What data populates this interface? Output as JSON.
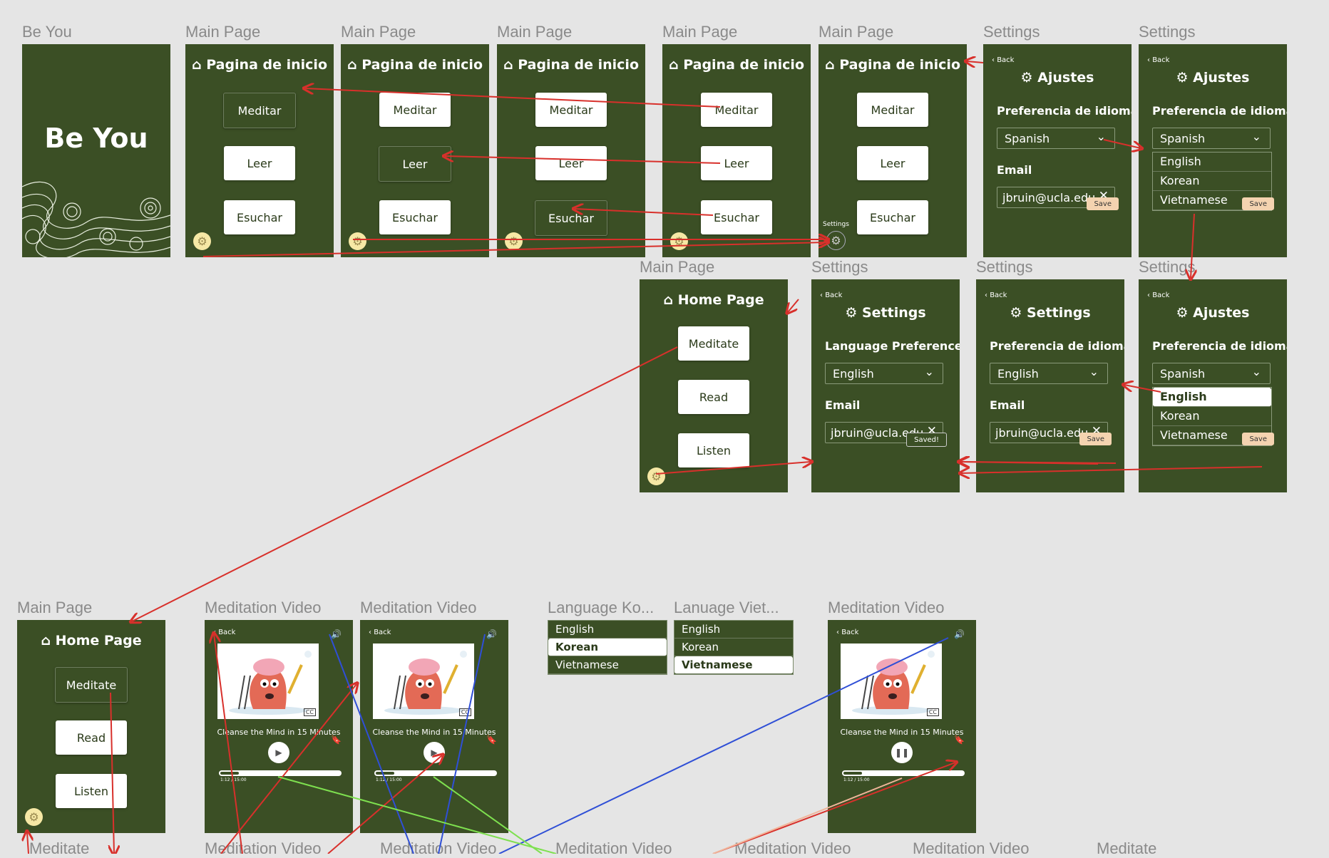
{
  "labels": {
    "be_you": "Be You",
    "main": "Main Page",
    "settings": "Settings",
    "video": "Meditation Video",
    "lang_ko": "Language Ko...",
    "lang_vi": "Lanuage Viet...",
    "meditate": "Meditate"
  },
  "splash": {
    "title": "Be You"
  },
  "main_es": {
    "title": "Pagina de inicio",
    "b1": "Meditar",
    "b2": "Leer",
    "b3": "Esuchar",
    "settings_tip": "Settings"
  },
  "main_en": {
    "title": "Home Page",
    "b1": "Meditate",
    "b2": "Read",
    "b3": "Listen"
  },
  "settings_es": {
    "back": "Back",
    "title": "Ajustes",
    "lang_label": "Preferencia de idioma",
    "lang_value": "Spanish",
    "email_label": "Email",
    "email_value": "jbruin@ucla.edu",
    "save": "Save",
    "options": [
      "English",
      "Korean",
      "Vietnamese"
    ]
  },
  "settings_en": {
    "back": "Back",
    "title": "Settings",
    "lang_label": "Language Preference",
    "lang_value": "English",
    "email_label": "Email",
    "email_value": "jbruin@ucla.edu",
    "saved": "Saved!"
  },
  "settings_mix": {
    "back": "Back",
    "title": "Settings",
    "lang_label": "Preferencia de idioma",
    "lang_value": "English",
    "email_label": "Email",
    "email_value": "jbruin@ucla.edu",
    "save": "Save"
  },
  "video": {
    "back": "Back",
    "caption": "Cleanse the Mind in 15 Minutes",
    "time": "1:12 / 15:00",
    "progress": 0.15
  },
  "lang_menu": {
    "options": [
      "English",
      "Korean",
      "Vietnamese"
    ]
  },
  "bottom_labels": [
    "Meditate",
    "Meditation Video",
    "Meditation Video",
    "Meditation Video",
    "Meditation Video",
    "Meditation Video",
    "Meditate"
  ],
  "colors": {
    "frame": "#3b4f25",
    "bg": "#e5e5e5",
    "arrow_red": "#d8302b",
    "arrow_blue": "#2f4fd6",
    "arrow_green": "#7ee04f",
    "arrow_peach": "#f0b59a"
  }
}
